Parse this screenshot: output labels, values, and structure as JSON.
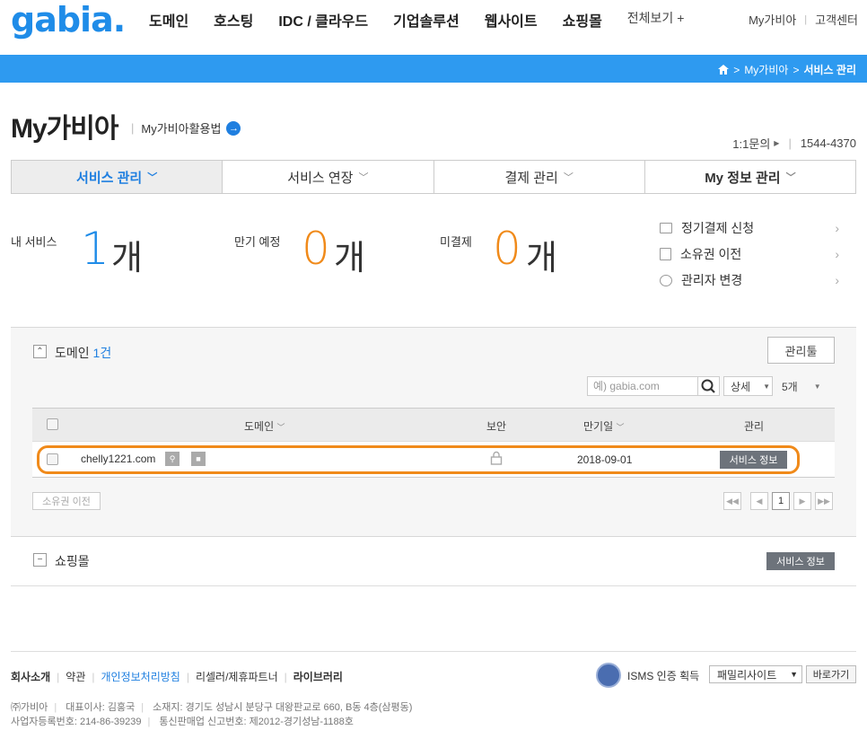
{
  "header": {
    "logo": "gabia.",
    "nav": [
      "도메인",
      "호스팅",
      "IDC / 클라우드",
      "기업솔루션",
      "웹사이트",
      "쇼핑몰"
    ],
    "view_all": "전체보기 +",
    "util": [
      "My가비아",
      "고객센터"
    ]
  },
  "breadcrumb": {
    "home_sep": ">",
    "level1": "My가비아",
    "sep": ">",
    "current": "서비스 관리"
  },
  "page": {
    "title": "My가비아",
    "howto": "My가비아활용법",
    "inquiry": "1:1문의",
    "phone": "1544-4370"
  },
  "tabs": [
    {
      "label": "서비스 관리"
    },
    {
      "label": "서비스 연장"
    },
    {
      "label": "결제 관리"
    },
    {
      "label": "My 정보 관리"
    }
  ],
  "summary": {
    "my_services": {
      "label": "내 서비스",
      "count": "1",
      "unit": "개"
    },
    "expiring": {
      "label": "만기 예정",
      "count": "0",
      "unit": "개"
    },
    "unpaid": {
      "label": "미결제",
      "count": "0",
      "unit": "개"
    },
    "quick_links": [
      "정기결제 신청",
      "소유권 이전",
      "관리자 변경"
    ]
  },
  "domain_section": {
    "title": "도메인",
    "count": "1건",
    "manage_button": "관리툴",
    "search_placeholder": "예) gabia.com",
    "detail_select": "상세",
    "page_size": "5개",
    "columns": {
      "domain": "도메인",
      "security": "보안",
      "expiry": "만기일",
      "manage": "관리"
    },
    "rows": [
      {
        "domain": "chelly1221.com",
        "expiry": "2018-09-01",
        "action": "서비스 정보"
      }
    ],
    "transfer_button": "소유권 이전",
    "current_page": "1"
  },
  "shop_section": {
    "title": "쇼핑몰",
    "action": "서비스 정보"
  },
  "footer": {
    "links": [
      "회사소개",
      "약관",
      "개인정보처리방침",
      "리셀러/제휴파트너",
      "라이브러리"
    ],
    "isms": "ISMS 인증 획득",
    "family": "패밀리사이트",
    "go": "바로가기",
    "info1": [
      "㈜가비아",
      "대표이사: 김홍국",
      "소재지: 경기도 성남시 분당구 대왕판교로 660, B동 4층(삼평동)"
    ],
    "info2": [
      "사업자등록번호: 214-86-39239",
      "통신판매업 신고번호: 제2012-경기성남-1188호"
    ]
  },
  "colors": {
    "brand_blue": "#1f8ce8",
    "bar_blue": "#2e9af0",
    "accent_orange": "#f08a1a",
    "highlight": "#f08a1a"
  }
}
